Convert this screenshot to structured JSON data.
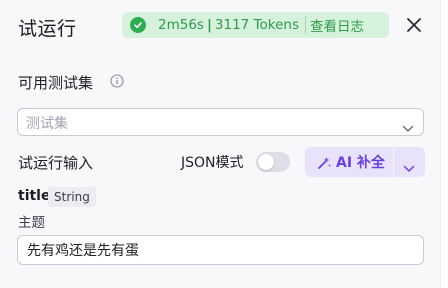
{
  "header": {
    "title": "试运行",
    "status": {
      "duration": "2m56s",
      "separator": "|",
      "tokens": "3117 Tokens",
      "log_link": "查看日志"
    }
  },
  "test_set": {
    "label": "可用测试集",
    "placeholder": "测试集"
  },
  "run_input": {
    "label": "试运行输入",
    "json_mode_label": "JSON模式",
    "json_mode_enabled": false,
    "ai_button_label": "AI 补全"
  },
  "param": {
    "name": "title",
    "type": "String",
    "description": "主题",
    "value": "先有鸡还是先有蛋"
  },
  "colors": {
    "status_bg": "#d6f2dc",
    "status_text": "#2f9b4a",
    "ai_bg": "#e8e3fb",
    "ai_text": "#6b3fe0"
  }
}
